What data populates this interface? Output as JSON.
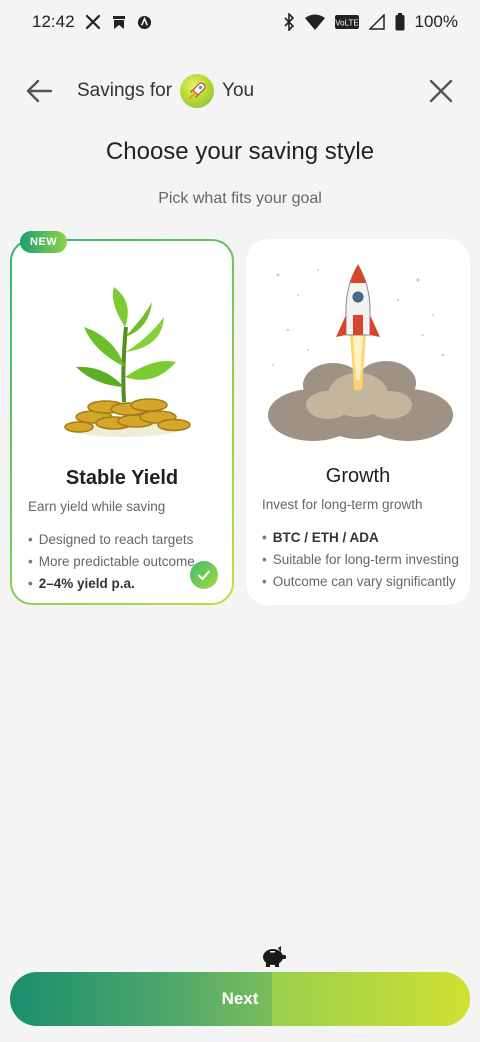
{
  "status_bar": {
    "time": "12:42",
    "battery": "100%",
    "icons_left": [
      "x-icon",
      "bookmark-icon",
      "app-icon"
    ],
    "icons_right": [
      "bluetooth-icon",
      "wifi-icon",
      "volte-icon",
      "signal-icon",
      "battery-icon"
    ],
    "volte_label": "VoLTE"
  },
  "nav": {
    "title": "Savings for",
    "user": "You"
  },
  "heading": "Choose your saving style",
  "subheading": "Pick what fits your goal",
  "cards": {
    "stable": {
      "badge": "NEW",
      "title": "Stable Yield",
      "subtitle": "Earn yield while saving",
      "bullets": [
        "Designed to reach targets",
        "More predictable outcome",
        "2–4% yield p.a."
      ],
      "selected": true
    },
    "growth": {
      "title": "Growth",
      "subtitle": "Invest for long-term growth",
      "bullets": [
        "BTC / ETH / ADA",
        "Suitable for long-term investing",
        "Outcome can vary significantly"
      ],
      "selected": false
    }
  },
  "next_button": {
    "label": "Next"
  },
  "colors": {
    "accent_green": "#2bb673",
    "accent_lime": "#c4e03c",
    "background": "#f4f4f4"
  }
}
